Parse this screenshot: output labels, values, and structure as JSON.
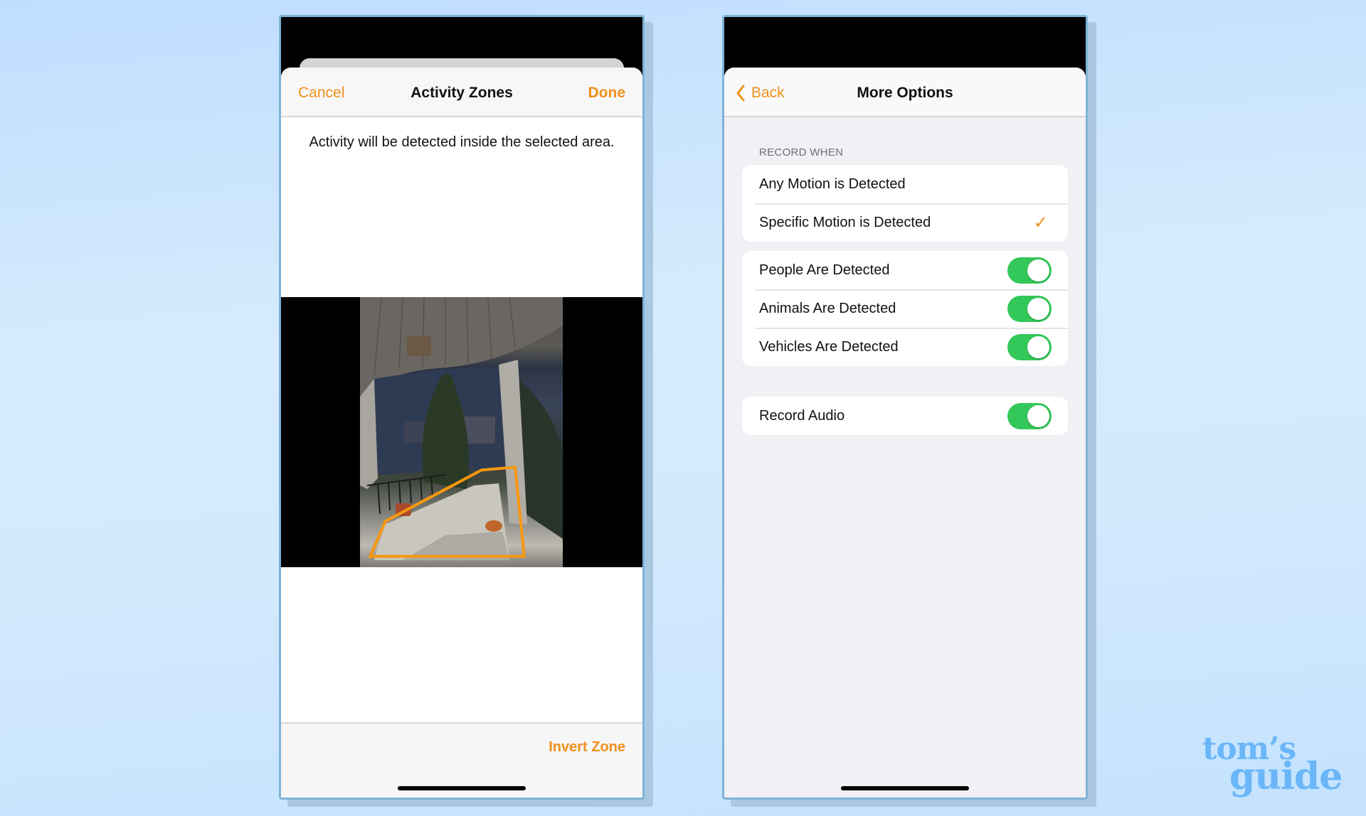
{
  "colors": {
    "accent": "#f0901a",
    "toggle_on": "#34c759",
    "zone_stroke": "#f7970f",
    "logo": "#6ab6f8"
  },
  "left_screen": {
    "nav": {
      "cancel_label": "Cancel",
      "title": "Activity Zones",
      "done_label": "Done"
    },
    "description": "Activity will be detected inside the selected area.",
    "camera_preview": {
      "icon": "doorbell-camera-view",
      "zone_polygon_normalized": [
        [
          0.05,
          0.96
        ],
        [
          0.125,
          0.83
        ],
        [
          0.6,
          0.64
        ],
        [
          0.765,
          0.63
        ],
        [
          0.81,
          0.96
        ]
      ]
    },
    "bottom": {
      "invert_zone_label": "Invert Zone"
    }
  },
  "right_screen": {
    "nav": {
      "back_label": "Back",
      "back_icon": "chevron-left-icon",
      "title": "More Options"
    },
    "record_when": {
      "header": "RECORD WHEN",
      "options": [
        {
          "label": "Any Motion is Detected",
          "selected": false
        },
        {
          "label": "Specific Motion is Detected",
          "selected": true
        }
      ],
      "check_glyph": "✓"
    },
    "detections": [
      {
        "label": "People Are Detected",
        "on": true
      },
      {
        "label": "Animals Are Detected",
        "on": true
      },
      {
        "label": "Vehicles Are Detected",
        "on": true
      }
    ],
    "audio": {
      "label": "Record Audio",
      "on": true
    }
  },
  "watermark": {
    "line1": "tom’s",
    "line2": "guide"
  }
}
